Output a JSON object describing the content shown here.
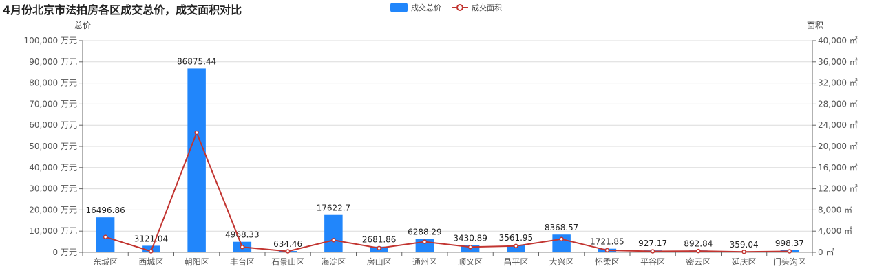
{
  "chart_data": {
    "type": "bar",
    "title": "4月份北京市法拍房各区成交总价，成交面积对比",
    "categories": [
      "东城区",
      "西城区",
      "朝阳区",
      "丰台区",
      "石景山区",
      "海淀区",
      "房山区",
      "通州区",
      "顺义区",
      "昌平区",
      "大兴区",
      "怀柔区",
      "平谷区",
      "密云区",
      "延庆区",
      "门头沟区"
    ],
    "series": [
      {
        "name": "成交总价",
        "type": "bar",
        "axis": "left",
        "color": "#2186fb",
        "values": [
          16496.86,
          3121.04,
          86875.44,
          4968.33,
          634.46,
          17622.7,
          2681.86,
          6288.29,
          3430.89,
          3561.95,
          8368.57,
          1721.85,
          927.17,
          892.84,
          359.04,
          998.37
        ],
        "labels": [
          "16496.86",
          "3121.04",
          "86875.44",
          "4968.33",
          "634.46",
          "17622.7",
          "2681.86",
          "6288.29",
          "3430.89",
          "3561.95",
          "8368.57",
          "1721.85",
          "927.17",
          "892.84",
          "359.04",
          "998.37"
        ]
      },
      {
        "name": "成交面积",
        "type": "line",
        "axis": "right",
        "color": "#c23531",
        "values": [
          2900,
          200,
          22600,
          1000,
          200,
          2300,
          800,
          2000,
          1000,
          1200,
          2500,
          400,
          200,
          250,
          100,
          200
        ]
      }
    ],
    "left_axis": {
      "name": "总价",
      "min": 0,
      "max": 100000,
      "ticks": [
        "0 万元",
        "10,000 万元",
        "20,000 万元",
        "30,000 万元",
        "40,000 万元",
        "50,000 万元",
        "60,000 万元",
        "70,000 万元",
        "80,000 万元",
        "90,000 万元",
        "100,000 万元"
      ]
    },
    "right_axis": {
      "name": "面积",
      "min": 0,
      "max": 40000,
      "ticks": [
        "0 ㎡",
        "4,000 ㎡",
        "8,000 ㎡",
        "12,000 ㎡",
        "16,000 ㎡",
        "20,000 ㎡",
        "24,000 ㎡",
        "28,000 ㎡",
        "32,000 ㎡",
        "36,000 ㎡",
        "40,000 ㎡"
      ]
    },
    "legend_position": "top-center",
    "grid": true
  }
}
